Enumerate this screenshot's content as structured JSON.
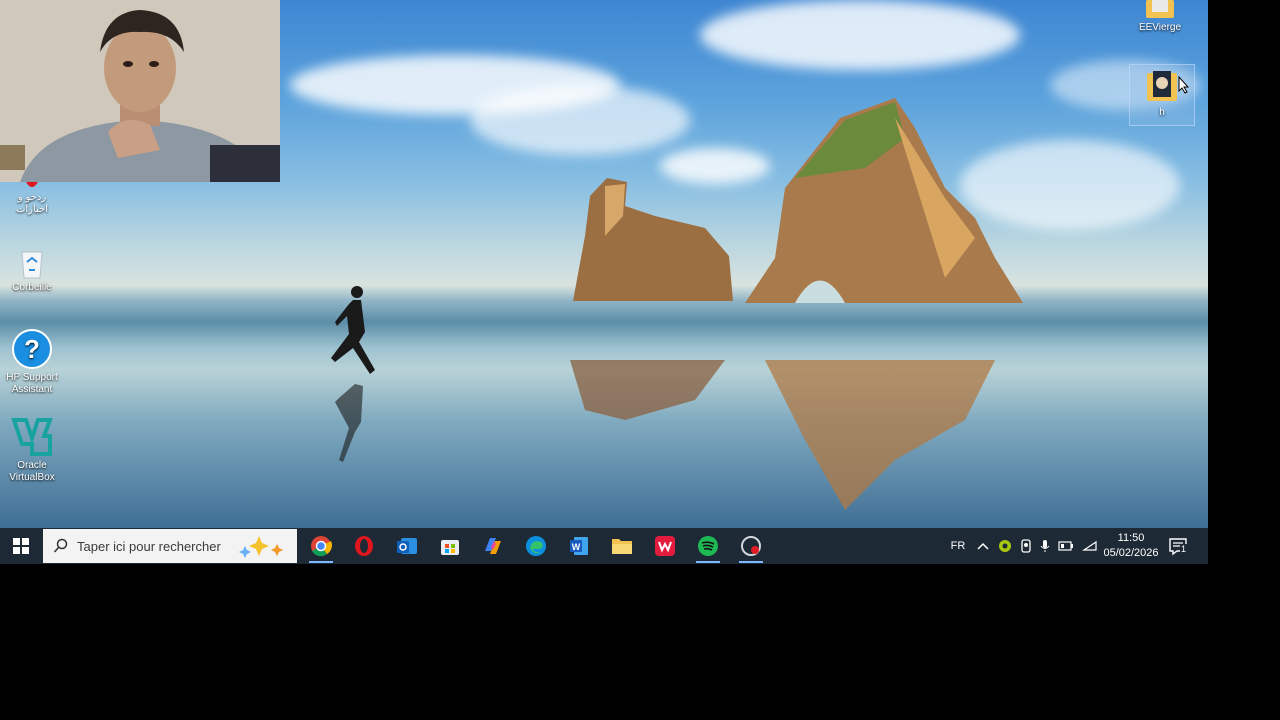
{
  "desktop": {
    "icons": [
      {
        "label": "EEVierge",
        "icon": "folder-icon"
      },
      {
        "label": "h",
        "icon": "folder-icon"
      },
      {
        "label": "ردخو و\nاخبارات",
        "icon": "opera-icon"
      },
      {
        "label": "Corbeille",
        "icon": "recycle-bin-icon"
      },
      {
        "label": "HP Support\nAssistant",
        "icon": "hp-support-icon"
      },
      {
        "label": "Oracle\nVirtualBox",
        "icon": "virtualbox-icon"
      }
    ]
  },
  "taskbar": {
    "search_placeholder": "Taper ici pour rechercher",
    "apps": [
      {
        "name": "Google Chrome",
        "icon": "chrome-icon",
        "active": true
      },
      {
        "name": "Opera",
        "icon": "opera-icon",
        "active": false
      },
      {
        "name": "Outlook",
        "icon": "outlook-icon",
        "active": false
      },
      {
        "name": "Microsoft Store",
        "icon": "store-icon",
        "active": false
      },
      {
        "name": "Copilot",
        "icon": "copilot-icon",
        "active": false
      },
      {
        "name": "Edge",
        "icon": "edge-icon",
        "active": false
      },
      {
        "name": "Word",
        "icon": "word-icon",
        "active": false
      },
      {
        "name": "File Explorer",
        "icon": "folder-icon",
        "active": false
      },
      {
        "name": "WPS Office",
        "icon": "wps-icon",
        "active": false
      },
      {
        "name": "Spotify",
        "icon": "spotify-icon",
        "active": true
      },
      {
        "name": "Screen recorder",
        "icon": "recorder-icon",
        "active": true
      }
    ],
    "tray": {
      "language": "FR",
      "time": "11:50",
      "date": "05/02/2026",
      "notification_count": "1"
    }
  },
  "colors": {
    "taskbar": "#1d2935",
    "accent": "#7fb7ff"
  }
}
